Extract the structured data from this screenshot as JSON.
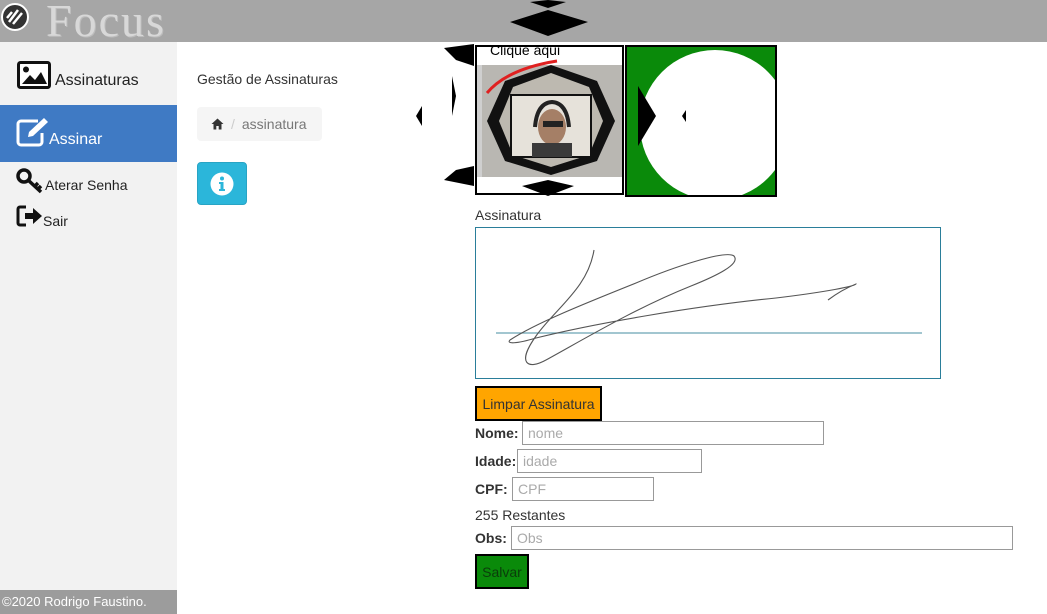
{
  "app": {
    "brand": "Focus",
    "logo_icon": "focus-logo-icon"
  },
  "sidebar": {
    "items": [
      {
        "label": "Assinaturas",
        "icon": "image-icon",
        "active": false
      },
      {
        "label": "Assinar",
        "icon": "edit-icon",
        "active": true
      },
      {
        "label": "Aterar Senha",
        "icon": "key-icon",
        "active": false
      },
      {
        "label": "Sair",
        "icon": "sign-out-icon",
        "active": false
      }
    ],
    "footer": "©2020 Rodrigo Faustino."
  },
  "main": {
    "title": "Gestão de Assinaturas",
    "breadcrumb": {
      "home_icon": "home-icon",
      "separator": "/",
      "current": "assinatura"
    },
    "info_icon": "info-icon"
  },
  "capture": {
    "click_here": "Clique aqui"
  },
  "signature": {
    "label": "Assinatura",
    "clear_button": "Limpar Assinatura"
  },
  "form": {
    "nome": {
      "label": "Nome:",
      "placeholder": "nome",
      "value": ""
    },
    "idade": {
      "label": "Idade:",
      "placeholder": "idade",
      "value": ""
    },
    "cpf": {
      "label": "CPF:",
      "placeholder": "CPF",
      "value": ""
    },
    "counter": "255 Restantes",
    "obs": {
      "label": "Obs:",
      "placeholder": "Obs",
      "value": ""
    },
    "save_button": "Salvar"
  },
  "colors": {
    "topbar": "#a6a6a6",
    "sidebar_active": "#3f7ac4",
    "info_button": "#2bb6da",
    "clear_button": "#ffa500",
    "save_button": "#0a8a0a",
    "preview_bg": "#0a8a0a"
  }
}
